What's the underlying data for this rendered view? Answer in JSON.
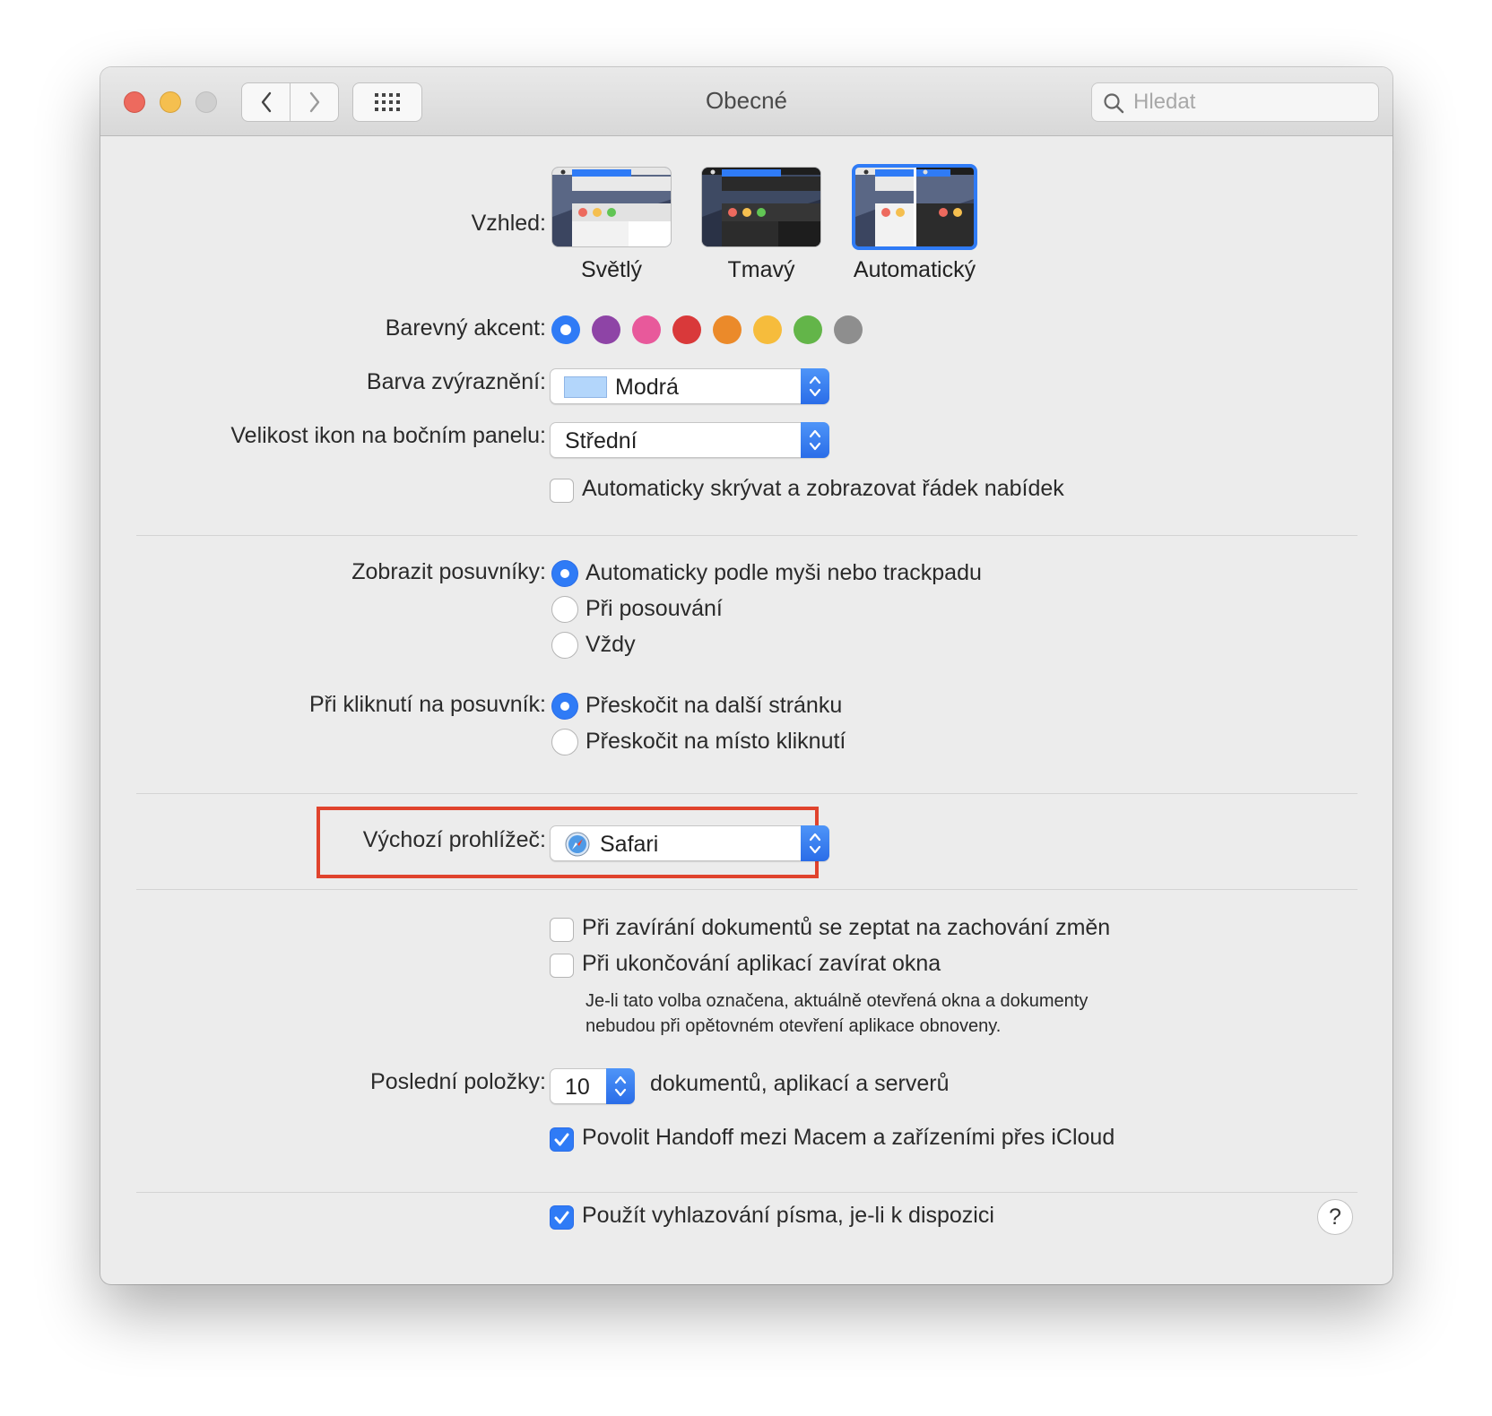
{
  "window": {
    "title": "Obecné",
    "search_placeholder": "Hledat"
  },
  "appearance": {
    "label": "Vzhled:",
    "options": [
      {
        "name": "Světlý",
        "selected": false
      },
      {
        "name": "Tmavý",
        "selected": false
      },
      {
        "name": "Automatický",
        "selected": true
      }
    ]
  },
  "accent": {
    "label": "Barevný akcent:",
    "colors": [
      "#2f7bf6",
      "#8e44a6",
      "#e8599b",
      "#d9393a",
      "#eb8a2a",
      "#f6bc3c",
      "#63b549",
      "#8e8e8e"
    ],
    "selected_index": 0
  },
  "highlight_color": {
    "label": "Barva zvýraznění:",
    "value": "Modrá",
    "swatch": "#b3d6fb"
  },
  "sidebar_icon_size": {
    "label": "Velikost ikon na bočním panelu:",
    "value": "Střední"
  },
  "auto_hide_menu": {
    "label": "Automaticky skrývat a zobrazovat řádek nabídek",
    "checked": false
  },
  "show_scrollbars": {
    "label": "Zobrazit posuvníky:",
    "options": [
      {
        "label": "Automaticky podle myši nebo trackpadu",
        "selected": true
      },
      {
        "label": "Při posouvání",
        "selected": false
      },
      {
        "label": "Vždy",
        "selected": false
      }
    ]
  },
  "click_scrollbar": {
    "label": "Při kliknutí na posuvník:",
    "options": [
      {
        "label": "Přeskočit na další stránku",
        "selected": true
      },
      {
        "label": "Přeskočit na místo kliknutí",
        "selected": false
      }
    ]
  },
  "default_browser": {
    "label": "Výchozí prohlížeč:",
    "value": "Safari"
  },
  "ask_keep_changes": {
    "label": "Při zavírání dokumentů se zeptat na zachování změn",
    "checked": false
  },
  "close_windows": {
    "label": "Při ukončování aplikací zavírat okna",
    "checked": false,
    "note_line1": "Je-li tato volba označena, aktuálně otevřená okna a dokumenty",
    "note_line2": "nebudou při opětovném otevření aplikace obnoveny."
  },
  "recent_items": {
    "label": "Poslední položky:",
    "value": "10",
    "suffix": "dokumentů, aplikací a serverů"
  },
  "handoff": {
    "label": "Povolit Handoff mezi Macem a zařízeními přes iCloud",
    "checked": true
  },
  "font_smoothing": {
    "label": "Použít vyhlazování písma, je-li k dispozici",
    "checked": true
  },
  "help_label": "?"
}
